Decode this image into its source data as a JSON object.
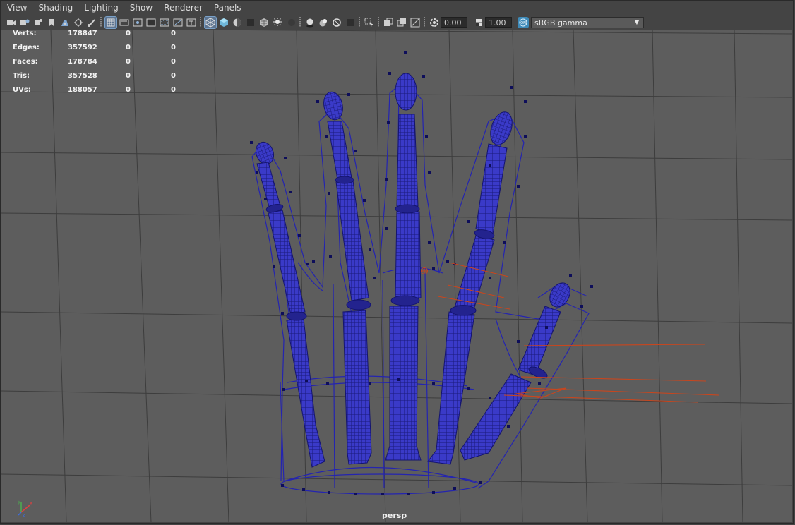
{
  "menu": [
    "View",
    "Shading",
    "Lighting",
    "Show",
    "Renderer",
    "Panels"
  ],
  "toolbar": {
    "icons": [
      "camera-icon",
      "camera-attributes-icon",
      "bookmark-icon",
      "image-plane-icon",
      "2d-pan-zoom-icon",
      "grease-pencil-icon",
      "grid-icon",
      "film-gate-icon",
      "resolution-gate-icon",
      "gate-mask-icon",
      "field-chart-icon",
      "safe-action-icon",
      "safe-title-icon",
      "wireframe-icon",
      "smooth-shade-icon",
      "default-material-icon",
      "textured-icon",
      "use-all-lights-icon",
      "shadows-icon",
      "screen-space-ao-icon",
      "motion-blur-icon",
      "anti-aliasing-icon",
      "depth-of-field-icon",
      "isolate-select-icon",
      "xray-icon",
      "xray-active-icon",
      "xray-joints-icon",
      "backface-culling-icon",
      "exposure-icon",
      "gamma-icon",
      "color-management-icon"
    ],
    "exposure": "0.00",
    "gamma": "1.00",
    "colorspace": "sRGB gamma"
  },
  "hud": {
    "rows": [
      {
        "label": "Verts:",
        "v1": "178847",
        "v2": "0",
        "v3": "0"
      },
      {
        "label": "Edges:",
        "v1": "357592",
        "v2": "0",
        "v3": "0"
      },
      {
        "label": "Faces:",
        "v1": "178784",
        "v2": "0",
        "v3": "0"
      },
      {
        "label": "Tris:",
        "v1": "357528",
        "v2": "0",
        "v3": "0"
      },
      {
        "label": "UVs:",
        "v1": "188057",
        "v2": "0",
        "v3": "0"
      }
    ]
  },
  "camera": "persp",
  "colors": {
    "viewport_bg": "#5d5d5d",
    "grid": "#3c3c3c",
    "wire": "#1d1d9c",
    "joints": "#c8461e",
    "accent": "#5d7490"
  }
}
